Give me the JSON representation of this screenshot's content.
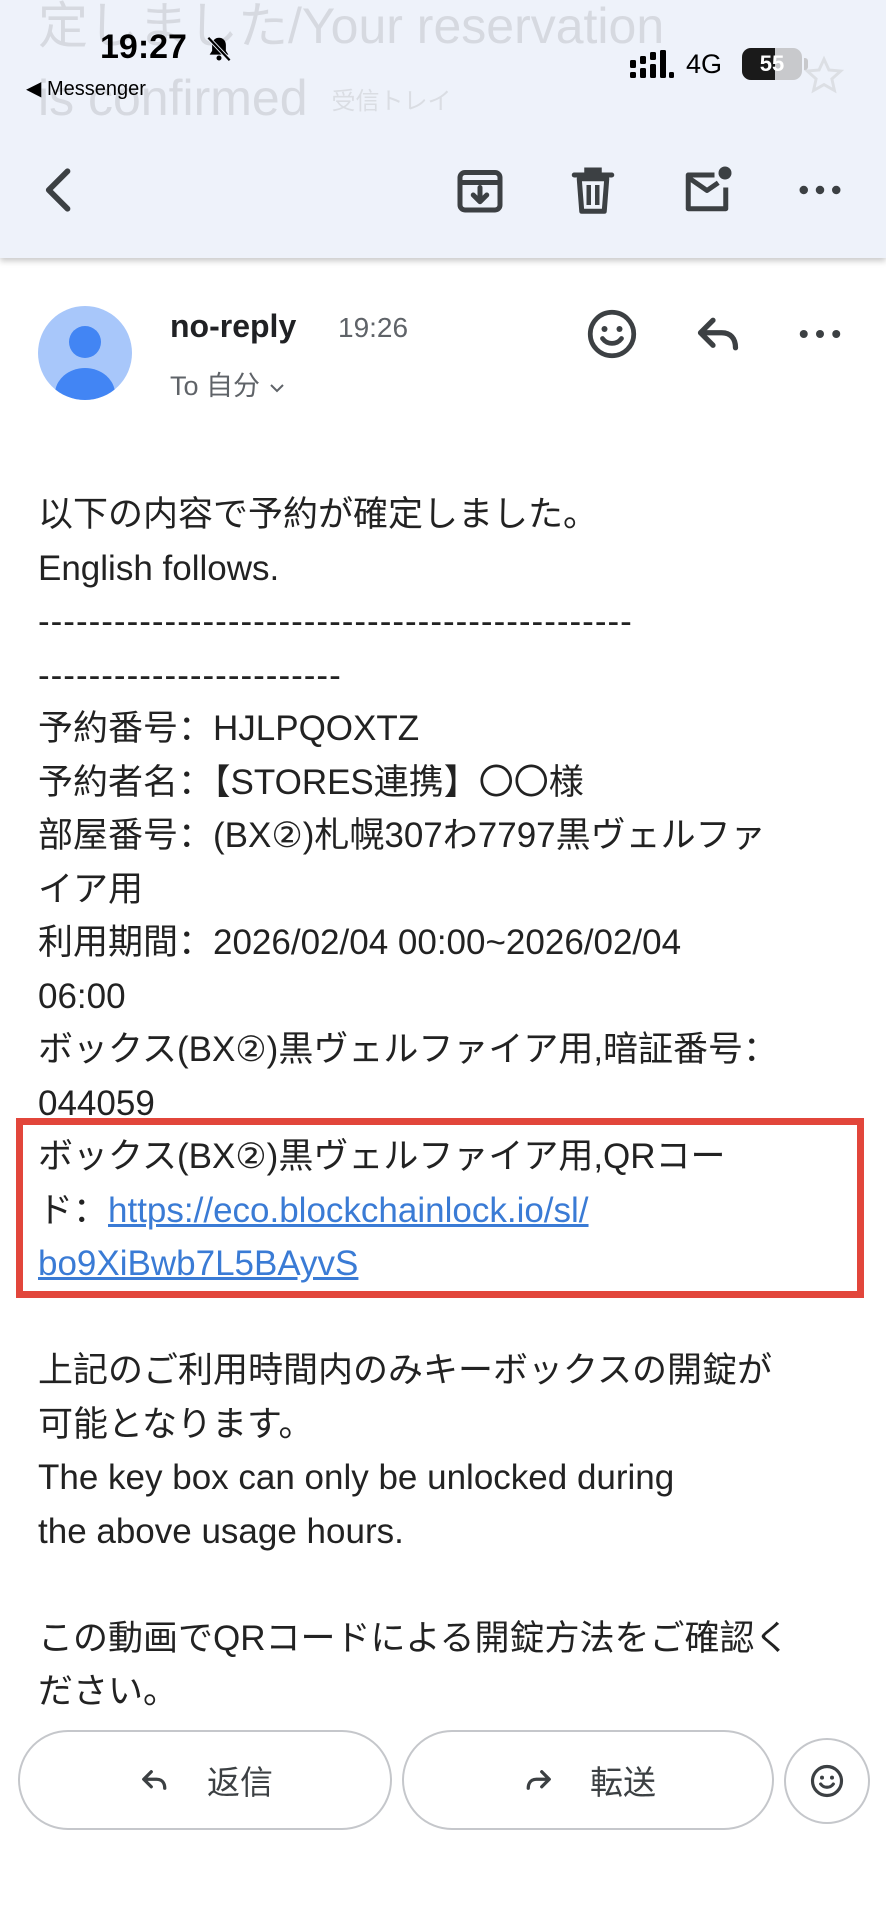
{
  "ghost_title": {
    "line1": "定しました/Your reservation",
    "line2": "is confirmed",
    "label": "受信トレイ"
  },
  "status_bar": {
    "time": "19:27",
    "back_app": "◀ Messenger",
    "network": "4G",
    "battery_percent": 55,
    "battery_text": "55"
  },
  "toolbar": {
    "icons": [
      "back-arrow-icon",
      "archive-icon",
      "delete-icon",
      "mark-unread-icon",
      "more-icon"
    ]
  },
  "sender": {
    "name": "no-reply",
    "time": "19:26",
    "recipient": "To 自分",
    "avatar_color": "#a8c7fa",
    "avatar_figure_color": "#4285f4"
  },
  "body": {
    "intro_ja": "以下の内容で予約が確定しました。",
    "intro_en": "English follows.",
    "separator_line1": "-----------------------------------------------",
    "separator_line2": "------------------------",
    "reservation_number": "予約番号：HJLPQOXTZ",
    "reserver_name": "予約者名：【STORES連携】〇〇様",
    "room_number_1": "部屋番号：(BX②)札幌307わ7797黒ヴェルファ",
    "room_number_2": "イア用",
    "period_1": "利用期間：2026/02/04 00:00~2026/02/04",
    "period_2": "06:00",
    "pin_1": "ボックス(BX②)黒ヴェルファイア用,暗証番号：",
    "pin_2": "044059",
    "qr_1": "ボックス(BX②)黒ヴェルファイア用,QRコー",
    "qr_2_prefix": "ド：",
    "qr_link_1": "https://eco.blockchainlock.io/sl/",
    "qr_link_2": "bo9XiBwb7L5BAyvS",
    "note_ja_1": "上記のご利用時間内のみキーボックスの開錠が",
    "note_ja_2": "可能となります。",
    "note_en_1": "The key box can only be unlocked during",
    "note_en_2": "the above usage hours.",
    "video_1": "この動画でQRコードによる開錠方法をご確認く",
    "video_2": "ださい。",
    "link_color": "#3a7bd5",
    "highlight_color": "#e2463b"
  },
  "actions": {
    "reply_label": "返信",
    "forward_label": "転送"
  }
}
